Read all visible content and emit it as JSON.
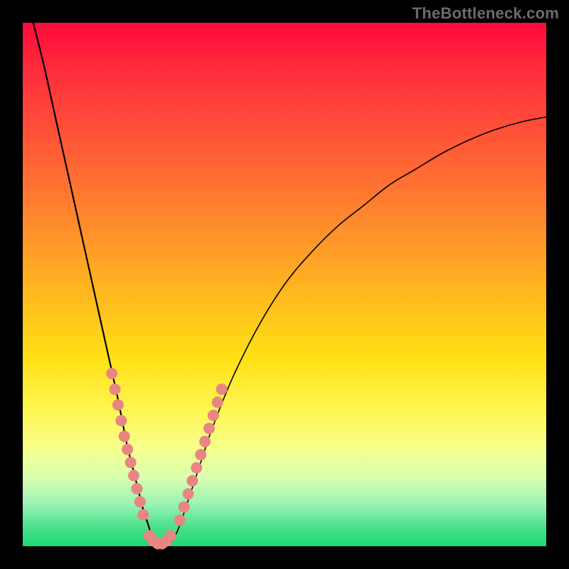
{
  "watermark": "TheBottleneck.com",
  "colors": {
    "background": "#000000",
    "curve": "#000000",
    "dots": "#e98583",
    "gradient_top": "#ff0a3a",
    "gradient_bottom": "#1dd772"
  },
  "chart_data": {
    "type": "line",
    "title": "",
    "xlabel": "",
    "ylabel": "",
    "xlim": [
      0,
      100
    ],
    "ylim": [
      0,
      100
    ],
    "grid": false,
    "series": [
      {
        "name": "left-branch",
        "x": [
          2,
          4,
          6,
          8,
          10,
          12,
          14,
          16,
          18,
          19,
          20,
          21,
          22,
          23,
          24,
          24.8
        ],
        "y": [
          100,
          92,
          83,
          74,
          65,
          56,
          47,
          38,
          29,
          24,
          19,
          15,
          11,
          7,
          4,
          1
        ]
      },
      {
        "name": "valley-floor",
        "x": [
          24.8,
          25.6,
          26.4,
          27.2,
          28.0,
          28.8
        ],
        "y": [
          1,
          0.3,
          0.2,
          0.3,
          0.6,
          1.4
        ]
      },
      {
        "name": "right-branch",
        "x": [
          28.8,
          30,
          32,
          34,
          36,
          40,
          45,
          50,
          55,
          60,
          65,
          70,
          75,
          80,
          85,
          90,
          95,
          100
        ],
        "y": [
          1.4,
          4,
          10,
          16,
          22,
          32,
          42,
          50,
          56,
          61,
          65,
          69,
          72,
          75,
          77.5,
          79.5,
          81,
          82
        ]
      }
    ],
    "markers": [
      {
        "name": "left-branch-dots",
        "x": [
          17.0,
          17.6,
          18.2,
          18.8,
          19.4,
          20.0,
          20.6,
          21.2,
          21.8,
          22.4,
          23.0
        ],
        "y": [
          33,
          30,
          27,
          24,
          21,
          18.5,
          16,
          13.5,
          11,
          8.5,
          6
        ]
      },
      {
        "name": "valley-dots",
        "x": [
          24.2,
          25.0,
          25.8,
          26.6,
          27.4,
          28.2
        ],
        "y": [
          2.0,
          1.0,
          0.5,
          0.5,
          1.0,
          2.0
        ]
      },
      {
        "name": "right-branch-dots",
        "x": [
          30.0,
          30.8,
          31.6,
          32.4,
          33.2,
          34.0,
          34.8,
          35.6,
          36.4,
          37.2,
          38.0
        ],
        "y": [
          5,
          7.5,
          10,
          12.5,
          15,
          17.5,
          20,
          22.5,
          25,
          27.5,
          30
        ]
      }
    ]
  }
}
